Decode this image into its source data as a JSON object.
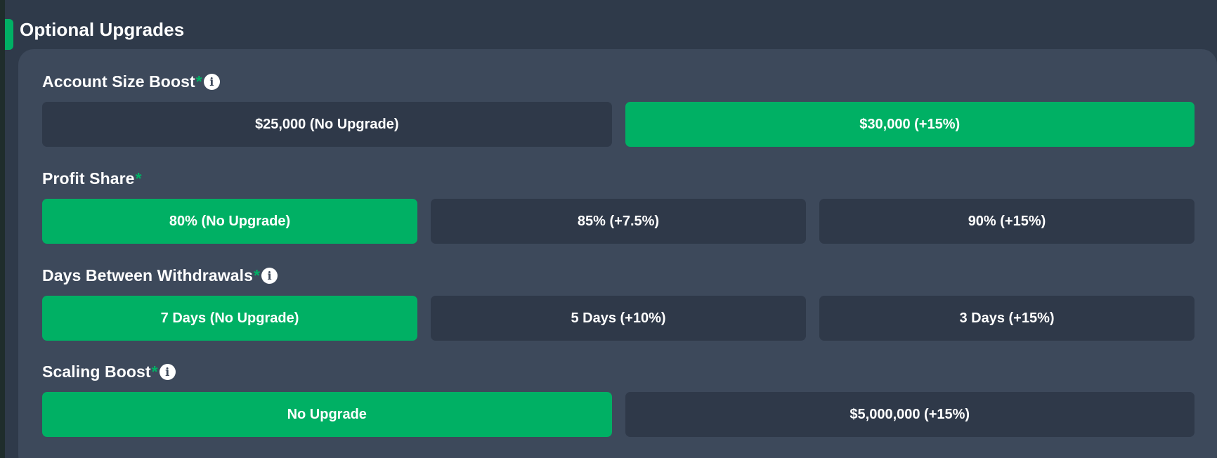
{
  "section": {
    "title": "Optional Upgrades"
  },
  "groups": {
    "account_size": {
      "label": "Account Size Boost",
      "required_mark": "*",
      "info_icon": "info-icon",
      "options": [
        {
          "label": "$25,000 (No Upgrade)",
          "selected": false
        },
        {
          "label": "$30,000 (+15%)",
          "selected": true
        }
      ]
    },
    "profit_share": {
      "label": "Profit Share",
      "required_mark": "*",
      "options": [
        {
          "label": "80% (No Upgrade)",
          "selected": true
        },
        {
          "label": "85% (+7.5%)",
          "selected": false
        },
        {
          "label": "90% (+15%)",
          "selected": false
        }
      ]
    },
    "withdrawals": {
      "label": "Days Between Withdrawals",
      "required_mark": "*",
      "info_icon": "info-icon",
      "options": [
        {
          "label": "7 Days (No Upgrade)",
          "selected": true
        },
        {
          "label": "5 Days (+10%)",
          "selected": false
        },
        {
          "label": "3 Days (+15%)",
          "selected": false
        }
      ]
    },
    "scaling": {
      "label": "Scaling Boost",
      "required_mark": "*",
      "info_icon": "info-icon",
      "options": [
        {
          "label": "No Upgrade",
          "selected": true
        },
        {
          "label": "$5,000,000 (+15%)",
          "selected": false
        }
      ]
    }
  },
  "colors": {
    "background": "#2f3a4a",
    "card": "#3d495b",
    "option_default": "#2f3949",
    "option_selected": "#00b064",
    "accent": "#00b064"
  }
}
